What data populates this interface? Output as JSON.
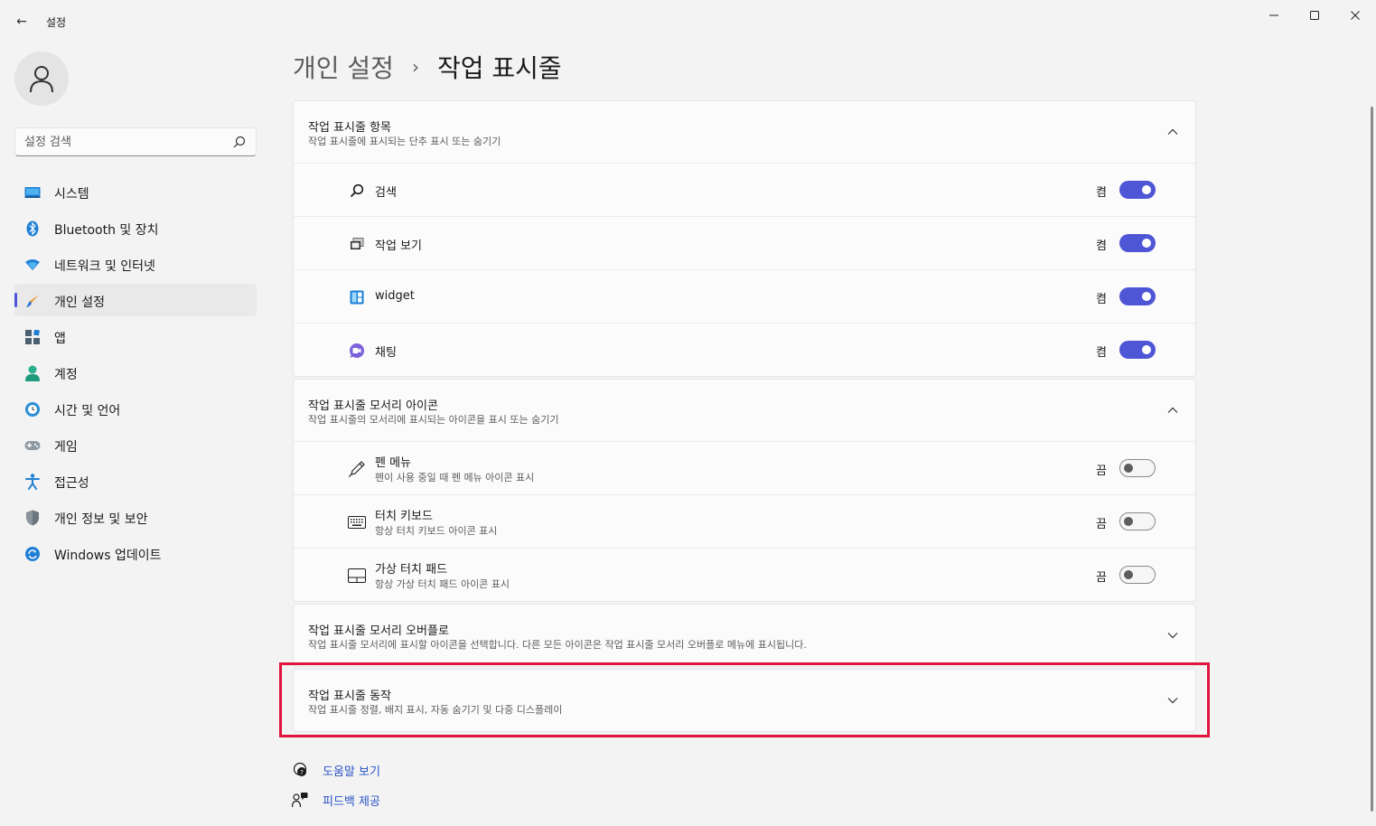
{
  "window": {
    "title": "설정",
    "back_glyph": "←",
    "minimize_glyph": "—",
    "maximize_glyph": "☐",
    "close_glyph": "✕"
  },
  "sidebar": {
    "search_placeholder": "설정 검색",
    "items": [
      {
        "label": "시스템",
        "icon": "system-icon",
        "active": false
      },
      {
        "label": "Bluetooth 및 장치",
        "icon": "bluetooth-icon",
        "active": false
      },
      {
        "label": "네트워크 및 인터넷",
        "icon": "wifi-icon",
        "active": false
      },
      {
        "label": "개인 설정",
        "icon": "brush-icon",
        "active": true
      },
      {
        "label": "앱",
        "icon": "apps-icon",
        "active": false
      },
      {
        "label": "계정",
        "icon": "account-icon",
        "active": false
      },
      {
        "label": "시간 및 언어",
        "icon": "globe-clock-icon",
        "active": false
      },
      {
        "label": "게임",
        "icon": "gamepad-icon",
        "active": false
      },
      {
        "label": "접근성",
        "icon": "accessibility-icon",
        "active": false
      },
      {
        "label": "개인 정보 및 보안",
        "icon": "shield-icon",
        "active": false
      },
      {
        "label": "Windows 업데이트",
        "icon": "update-icon",
        "active": false
      }
    ]
  },
  "breadcrumb": {
    "parent": "개인 설정",
    "separator": "›",
    "current": "작업 표시줄"
  },
  "sections": {
    "items": {
      "title": "작업 표시줄 항목",
      "desc": "작업 표시줄에 표시되는 단추 표시 또는 숨기기",
      "rows": [
        {
          "label": "검색",
          "state": "켬",
          "on": true,
          "icon": "search-icon"
        },
        {
          "label": "작업 보기",
          "state": "켬",
          "on": true,
          "icon": "task-view-icon"
        },
        {
          "label": "widget",
          "state": "켬",
          "on": true,
          "icon": "widget-icon"
        },
        {
          "label": "채팅",
          "state": "켬",
          "on": true,
          "icon": "chat-icon"
        }
      ]
    },
    "corner_icons": {
      "title": "작업 표시줄 모서리 아이콘",
      "desc": "작업 표시줄의 모서리에 표시되는 아이콘을 표시 또는 숨기기",
      "rows": [
        {
          "label": "펜 메뉴",
          "sub": "펜이 사용 중일 때 펜 메뉴 아이콘 표시",
          "state": "끔",
          "on": false,
          "icon": "pen-icon"
        },
        {
          "label": "터치 키보드",
          "sub": "항상 터치 키보드 아이콘 표시",
          "state": "끔",
          "on": false,
          "icon": "keyboard-icon"
        },
        {
          "label": "가상 터치 패드",
          "sub": "항상 가상 터치 패드 아이콘 표시",
          "state": "끔",
          "on": false,
          "icon": "touchpad-icon"
        }
      ]
    },
    "overflow": {
      "title": "작업 표시줄 모서리 오버플로",
      "desc": "작업 표시줄 모서리에 표시할 아이콘을 선택합니다. 다른 모든 아이콘은 작업 표시줄 모서리 오버플로 메뉴에 표시됩니다."
    },
    "behavior": {
      "title": "작업 표시줄 동작",
      "desc": "작업 표시줄 정렬, 배지 표시, 자동 숨기기 및 다중 디스플레이"
    }
  },
  "links": {
    "help": "도움말 보기",
    "feedback": "피드백 제공"
  },
  "colors": {
    "accent": "#4f56d6",
    "highlight": "#e0143c",
    "link": "#2a54c7"
  }
}
